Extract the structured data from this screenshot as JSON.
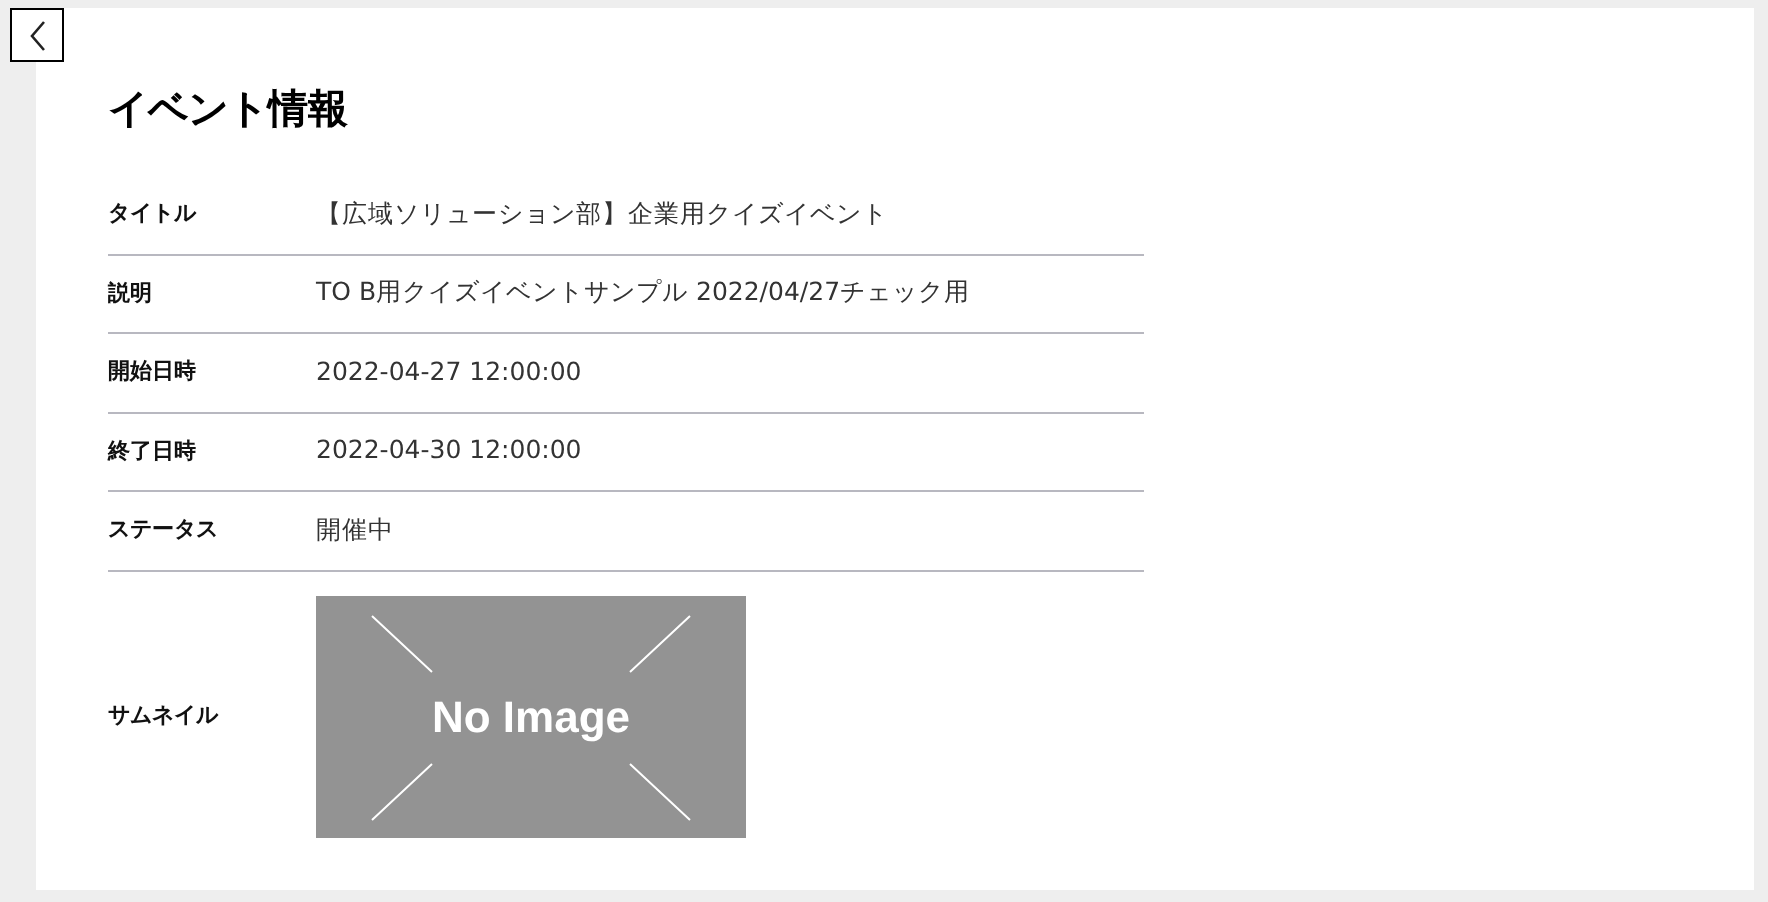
{
  "heading": "イベント情報",
  "rows": [
    {
      "kind": "text",
      "label": "タイトル",
      "value": "【広域ソリューション部】企業用クイズイベント"
    },
    {
      "kind": "text",
      "label": "説明",
      "value": "TO B用クイズイベントサンプル 2022/04/27チェック用"
    },
    {
      "kind": "text",
      "label": "開始日時",
      "value": "2022-04-27 12:00:00"
    },
    {
      "kind": "text",
      "label": "終了日時",
      "value": "2022-04-30 12:00:00"
    },
    {
      "kind": "text",
      "label": "ステータス",
      "value": "開催中"
    },
    {
      "kind": "image",
      "label": "サムネイル",
      "value": "No Image"
    }
  ]
}
